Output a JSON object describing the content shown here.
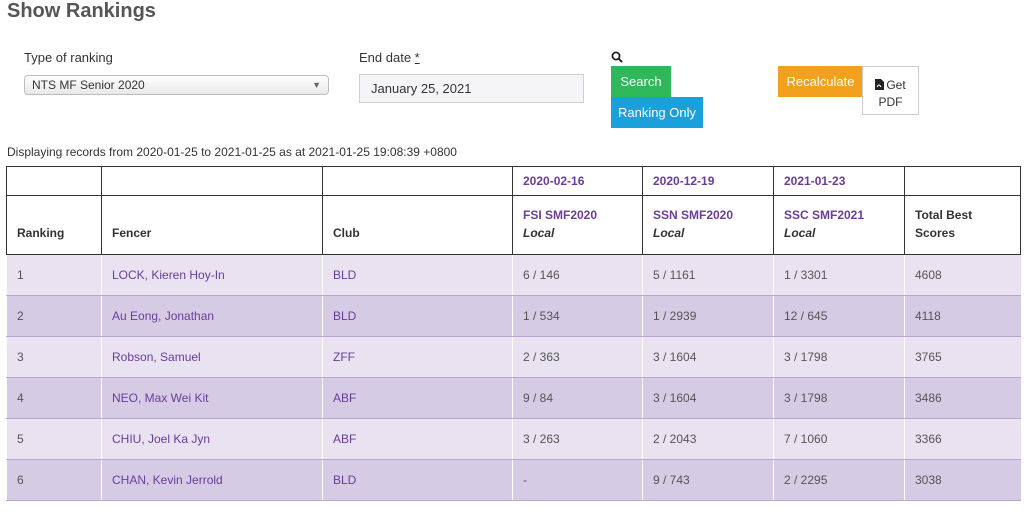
{
  "page": {
    "title": "Show Rankings"
  },
  "filters": {
    "type_label": "Type of ranking",
    "type_value": "NTS MF Senior 2020",
    "end_date_label": "End date",
    "required_mark": "*",
    "end_date_value": "January 25, 2021"
  },
  "actions": {
    "search_label": "Search",
    "ranking_only_label": "Ranking Only",
    "recalculate_label": "Recalculate",
    "get_pdf_label_1": "Get",
    "get_pdf_label_2": "PDF"
  },
  "summary": "Displaying records from 2020-01-25 to 2021-01-25 as at 2021-01-25 19:08:39 +0800",
  "table": {
    "headers": {
      "ranking": "Ranking",
      "fencer": "Fencer",
      "club": "Club",
      "total": "Total Best Scores"
    },
    "events": [
      {
        "date": "2020-02-16",
        "name": "FSI SMF2020",
        "scope": "Local"
      },
      {
        "date": "2020-12-19",
        "name": "SSN SMF2020",
        "scope": "Local"
      },
      {
        "date": "2021-01-23",
        "name": "SSC SMF2021",
        "scope": "Local"
      }
    ],
    "rows": [
      {
        "rank": "1",
        "fencer": "LOCK, Kieren Hoy-In",
        "club": "BLD",
        "e1": "6 / 146",
        "e2": "5 / 1161",
        "e3": "1 / 3301",
        "total": "4608"
      },
      {
        "rank": "2",
        "fencer": "Au Eong, Jonathan",
        "club": "BLD",
        "e1": "1 / 534",
        "e2": "1 / 2939",
        "e3": "12 / 645",
        "total": "4118"
      },
      {
        "rank": "3",
        "fencer": "Robson, Samuel",
        "club": "ZFF",
        "e1": "2 / 363",
        "e2": "3 / 1604",
        "e3": "3 / 1798",
        "total": "3765"
      },
      {
        "rank": "4",
        "fencer": "NEO, Max Wei Kit",
        "club": "ABF",
        "e1": "9 / 84",
        "e2": "3 / 1604",
        "e3": "3 / 1798",
        "total": "3486"
      },
      {
        "rank": "5",
        "fencer": "CHIU, Joel Ka Jyn",
        "club": "ABF",
        "e1": "3 / 263",
        "e2": "2 / 2043",
        "e3": "7 / 1060",
        "total": "3366"
      },
      {
        "rank": "6",
        "fencer": "CHAN, Kevin Jerrold",
        "club": "BLD",
        "e1": "-",
        "e2": "9 / 743",
        "e3": "2 / 2295",
        "total": "3038"
      }
    ]
  }
}
